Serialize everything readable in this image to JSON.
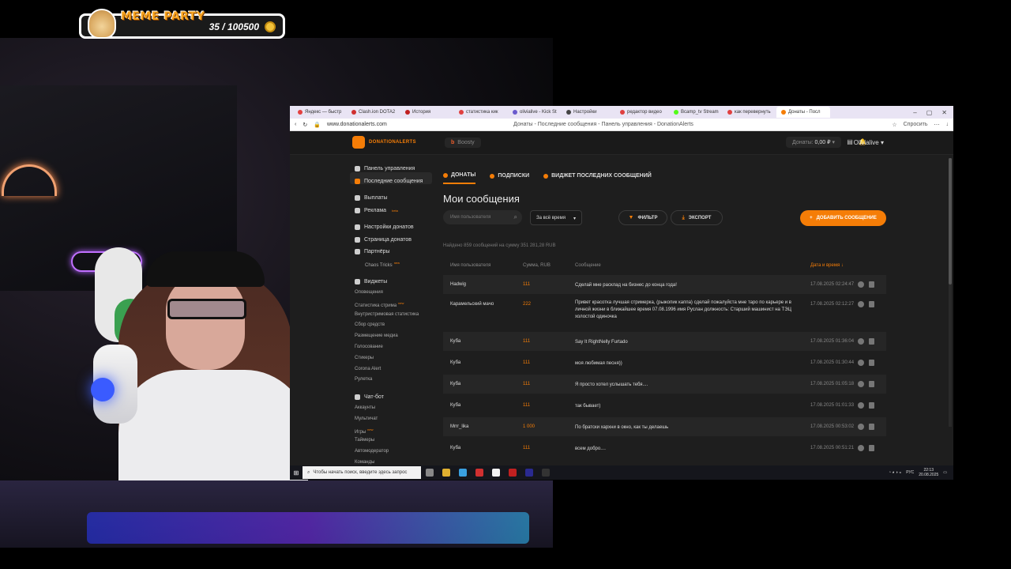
{
  "overlay": {
    "title": "MEME PARTY",
    "counter": "35 / 100500"
  },
  "browser": {
    "tabs": [
      {
        "label": "Яндекс — быстр",
        "color": "#e34040"
      },
      {
        "label": "Clash.ion DOTA2",
        "color": "#d03030"
      },
      {
        "label": "История",
        "color": "#c02020"
      },
      {
        "label": "статистика кик",
        "color": "#e04040"
      },
      {
        "label": "olivialive - Kick St",
        "color": "#6a5acd"
      },
      {
        "label": "Настройки",
        "color": "#444444"
      },
      {
        "label": "редактор видео",
        "color": "#e04040"
      },
      {
        "label": "Bcamp_tv Stream",
        "color": "#53fc18"
      },
      {
        "label": "как перевернуть",
        "color": "#e04040"
      },
      {
        "label": "Донаты - Посл",
        "color": "#f57d07",
        "active": true
      }
    ],
    "url": "www.donationalerts.com",
    "page_title": "Донаты - Последние сообщения - Панель управления - DonationAlerts",
    "ask_label": "Спросить"
  },
  "header": {
    "logo": "DONATIONALERTS",
    "boosty": "Boosty",
    "donats_label": "Донаты:",
    "donats_value": "0,00 ₽",
    "user": "Olivialive"
  },
  "sidebar": {
    "main_items": [
      {
        "label": "Панель управления"
      },
      {
        "label": "Последние сообщения",
        "active": true
      },
      {
        "label": "Выплаты"
      },
      {
        "label": "Реклама",
        "new": "beta"
      },
      {
        "label": "Настройки донатов"
      },
      {
        "label": "Страница донатов"
      },
      {
        "label": "Партнёры"
      },
      {
        "label": "Chaos Tricks",
        "new": "new",
        "sub": true
      },
      {
        "label": "Виджеты"
      },
      {
        "label": "Чат-бот"
      }
    ],
    "widget_sub": [
      "Оповещения",
      "Статистика стрима",
      "Внутристримовая статистика",
      "Сбор средств",
      "Размещение медиа",
      "Голосование",
      "Стикеры",
      "Corona Alert",
      "Рулетка"
    ],
    "stream_stat_new": "new",
    "chat_sub": [
      "Аккаунты",
      "Мультичат",
      "Игры",
      "Таймеры",
      "Автомодератор",
      "Команды"
    ],
    "games_new": "new"
  },
  "main": {
    "tabs": [
      "ДОНАТЫ",
      "ПОДПИСКИ",
      "ВИДЖЕТ ПОСЛЕДНИХ СООБЩЕНИЙ"
    ],
    "title": "Мои сообщения",
    "search_placeholder": "Имя пользователя",
    "period": "За всё время",
    "filter_label": "ФИЛЬТР",
    "export_label": "ЭКСПОРТ",
    "add_label": "ДОБАВИТЬ СООБЩЕНИЕ",
    "found_text": "Найдено 859 сообщений на сумму 351 281,28 RUB",
    "columns": [
      "Имя пользователя",
      "Сумма, RUB",
      "Сообщение",
      "Дата и время ↓"
    ],
    "rows": [
      {
        "user": "Hadwig",
        "sum": "111",
        "msg": "Сделай мне расклад на бизнес до конца года!",
        "dt": "17.08.2025 02:24:47"
      },
      {
        "user": "Карамельский мачо",
        "sum": "222",
        "msg": "Привет красотка лучшая стримерка, (рыжопик каппа) сделай пожалуйста мне таро по карьере и в личной жизни в ближайшее время 07.08.1996 имя Руслан должность: Старший машинист на ТЭЦ холостой одиночка",
        "dt": "17.08.2025 02:12:27",
        "tall": true
      },
      {
        "user": "Куба",
        "sum": "111",
        "msg": "Say It RightNelly Furtado",
        "dt": "17.08.2025 01:36:04"
      },
      {
        "user": "Куба",
        "sum": "111",
        "msg": "моя любимая песня))",
        "dt": "17.08.2025 01:30:44"
      },
      {
        "user": "Куба",
        "sum": "111",
        "msg": "Я просто хотел услышать тебя....",
        "dt": "17.08.2025 01:05:18"
      },
      {
        "user": "Куба",
        "sum": "111",
        "msg": "так бывает)",
        "dt": "17.08.2025 01:01:33"
      },
      {
        "user": "Mrrr_lika",
        "sum": "1 000",
        "msg": "По братски хархни в окно, как ты делаешь",
        "dt": "17.08.2025 00:53:02"
      },
      {
        "user": "Куба",
        "sum": "111",
        "msg": "всем добро....",
        "dt": "17.08.2025 00:51:21"
      }
    ]
  },
  "taskbar": {
    "search_placeholder": "Чтобы начать поиск, введите здесь запрос",
    "lang": "РУС",
    "time": "22:13",
    "date": "20.08.2025",
    "apps": [
      "#888888",
      "#e0b030",
      "#3aa0e0",
      "#d03030",
      "#f2f2f2",
      "#c02020",
      "#2a2a90",
      "#333333"
    ]
  }
}
